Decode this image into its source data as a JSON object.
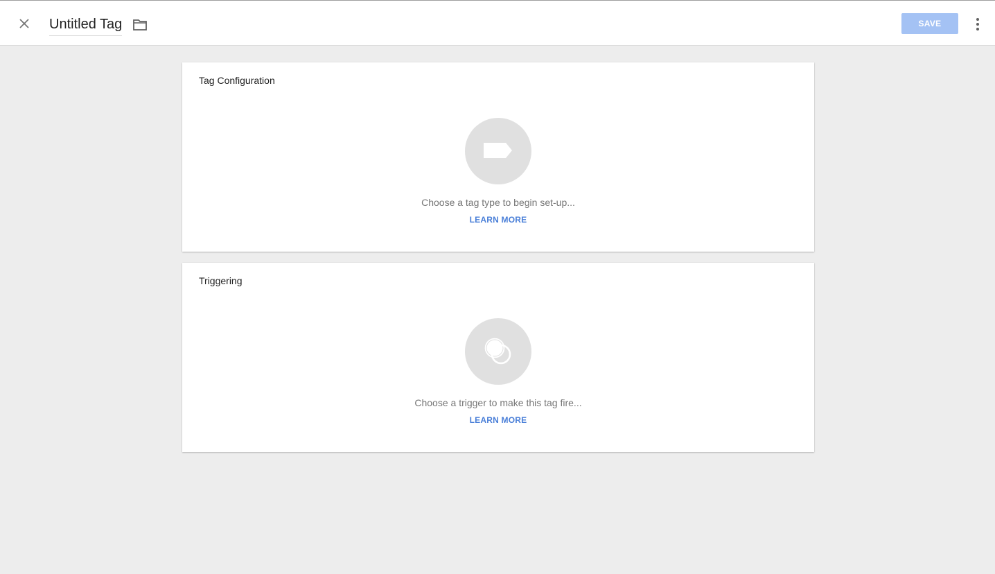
{
  "header": {
    "title": "Untitled Tag",
    "save_label": "SAVE",
    "icons": [
      "close-icon",
      "folder-icon",
      "more-vert-icon"
    ]
  },
  "cards": [
    {
      "title": "Tag Configuration",
      "icon": "tag-icon",
      "hint": "Choose a tag type to begin set-up...",
      "link": "LEARN MORE"
    },
    {
      "title": "Triggering",
      "icon": "trigger-icon",
      "hint": "Choose a trigger to make this tag fire...",
      "link": "LEARN MORE"
    }
  ],
  "colors": {
    "save_button": "#a4c2f4",
    "link": "#4a7fd8",
    "background": "#ededed",
    "icon_circle": "#e0e0e0"
  }
}
